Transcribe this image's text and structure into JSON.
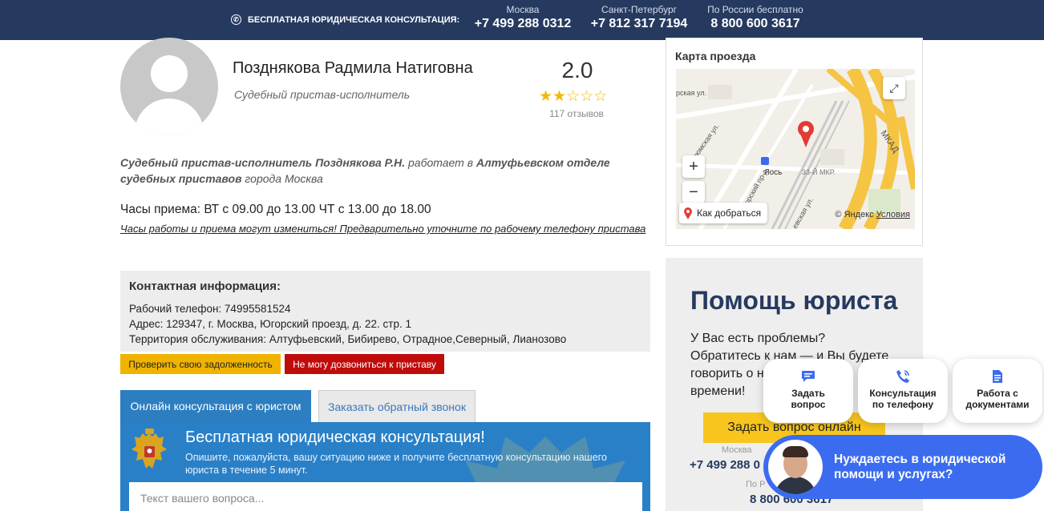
{
  "topbar": {
    "consult_label": "БЕСПЛАТНАЯ ЮРИДИЧЕСКАЯ КОНСУЛЬТАЦИЯ:",
    "cities": [
      {
        "name": "Москва",
        "phone": "+7 499 288 0312"
      },
      {
        "name": "Санкт-Петербург",
        "phone": "+7 812 317 7194"
      },
      {
        "name": "По России бесплатно",
        "phone": "8 800 600 3617"
      }
    ]
  },
  "profile": {
    "name": "Позднякова Радмила Натиговна",
    "role": "Судебный пристав-исполнитель",
    "rating": "2.0",
    "stars_filled": 2,
    "stars_total": 5,
    "reviews": "117 отзывов"
  },
  "description": {
    "part1": "Судебный пристав-исполнитель Позднякова Р.Н.",
    "part2": " работает в ",
    "part3": "Алтуфьевском отделе судебных приставов",
    "part4": " города Москва"
  },
  "hours": {
    "text": "Часы приема: ВТ с 09.00 до 13.00 ЧТ с 13.00 до 18.00",
    "note": "Часы работы и приема могут измениться! Предварительно уточните по рабочему телефону пристава"
  },
  "contact": {
    "title": "Контактная информация:",
    "phone": "Рабочий телефон: 74995581524",
    "address": "Адрес: 129347, г. Москва, Югорский проезд, д. 22. стр. 1",
    "territory": "Территория обслуживания: Алтуфьевский, Бибирево, Отрадное,Северный, Лианозово"
  },
  "actions": {
    "debt": "Проверить свою задолженность",
    "cant_call": "Не могу дозвониться к приставу"
  },
  "tabs": {
    "online": "Онлайн консультация с юристом",
    "callback": "Заказать обратный звонок"
  },
  "consult": {
    "title": "Бесплатная юридическая консультация!",
    "subtitle": "Опишите, пожалуйста, вашу ситуацию ниже и получите бесплатную консультацию нашего юриста в течение 5 минут.",
    "placeholder": "Текст вашего вопроса..."
  },
  "map": {
    "title": "Карта проезда",
    "route": "Как добраться",
    "copyright": "© Яндекс",
    "terms": "Условия",
    "labels": [
      "МКАД",
      "Лось",
      "33-Й МКР.",
      "рская ул.",
      "Угрюмская ул.",
      "орский пр-д",
      "евская ул."
    ]
  },
  "help": {
    "title": "Помощь юриста",
    "text": "У Вас есть проблемы? Обратитесь к нам — и Вы будете говорить о н... времени!",
    "text_line1": "У Вас есть проблемы?",
    "text_line2": "Обратитесь к нам — и Вы будете",
    "text_line3": "говорить о н",
    "text_line4": "времени!",
    "button": "Задать вопрос онлайн",
    "city1": "Москва",
    "phone1": "+7 499 288 0",
    "city2": "По Р",
    "phone2": "8 800 600 3617"
  },
  "float": {
    "ask": "Задать вопрос",
    "phone": "Консультация по телефону",
    "docs": "Работа с документами",
    "need_help": "Нуждаетесь в юридической помощи и услугах?"
  },
  "colors": {
    "topbar": "#263a60",
    "accent_blue": "#2c7ec0",
    "yellow": "#f0b400",
    "red": "#c00b0b",
    "chat_blue": "#3b6cf0"
  }
}
